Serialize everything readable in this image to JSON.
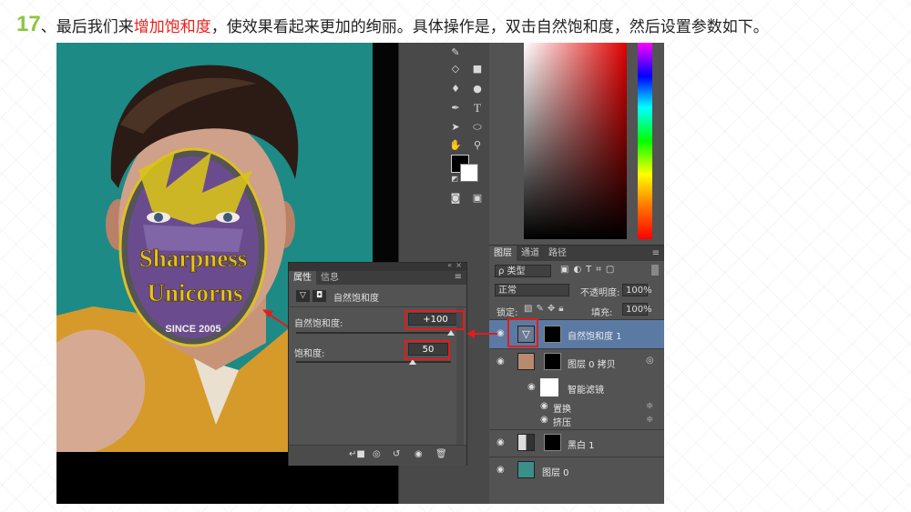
{
  "heading": {
    "step": "17",
    "sep": "、",
    "part1": "最后我们来",
    "highlight": "增加饱和度",
    "part2": "，使效果看起来更加的绚丽。具体操作是，双击自然饱和度，然后设置参数如下。"
  },
  "photo": {
    "logo_line1": "Sharpness",
    "logo_line2": "Unicorns",
    "logo_line3": "SINCE 2005"
  },
  "layers_panel": {
    "tabs": [
      "图层",
      "通道",
      "路径"
    ],
    "filter_kind": "ρ 类型",
    "blend_mode": "正常",
    "opacity_label": "不透明度:",
    "opacity_value": "100%",
    "lock_label": "锁定:",
    "fill_label": "填充:",
    "fill_value": "100%",
    "layers": [
      {
        "name": "自然饱和度 1",
        "selected": true
      },
      {
        "name": "图层 0 拷贝"
      },
      {
        "name": "智能滤镜"
      },
      {
        "name": "置换"
      },
      {
        "name": "挤压"
      },
      {
        "name": "黑白 1"
      },
      {
        "name": "图层 0"
      }
    ]
  },
  "properties_panel": {
    "tabs": [
      "属性",
      "信息"
    ],
    "title": "自然饱和度",
    "vibrance_label": "自然饱和度:",
    "vibrance_value": "+100",
    "vibrance_level": 1.0,
    "saturation_label": "饱和度:",
    "saturation_value": "50",
    "saturation_level": 0.75
  },
  "tools": {
    "text_tool_glyph": "T"
  },
  "colors": {
    "accent_red": "#e41b1b",
    "highlight_red": "#e8211d",
    "step_green": "#8cc63f"
  }
}
